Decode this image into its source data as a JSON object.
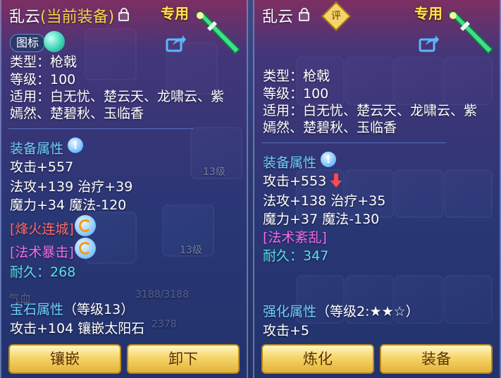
{
  "left": {
    "title_name": "乱云",
    "title_status": "(当前装备)",
    "exclusive": "专用",
    "icon_toggle": "图标",
    "type": "类型：枪戟",
    "level": "等级：100",
    "usable_line1": "适用：白无忧、楚云天、龙啸云、紫",
    "usable_line2": "嫣然、楚碧秋、玉临香",
    "attr_header": "装备属性",
    "attack": "攻击+557",
    "line_magic": "法攻+139 治疗+39",
    "line_power": "魔力+34 魔法-120",
    "skill1": "[烽火连城]",
    "skill2": "[法术暴击]",
    "durability_label": "耐久：",
    "durability_value": "268",
    "gem_header": "宝石属性",
    "gem_level": "（等级13）",
    "gem_line": "攻击+104 镶嵌太阳石",
    "btn_inlay": "镶嵌",
    "btn_unload": "卸下"
  },
  "right": {
    "title_name": "乱云",
    "rate_icon": "评",
    "exclusive": "专用",
    "type": "类型：枪戟",
    "level": "等级：100",
    "usable_line1": "适用：白无忧、楚云天、龙啸云、紫",
    "usable_line2": "嫣然、楚碧秋、玉临香",
    "attr_header": "装备属性",
    "attack": "攻击+553",
    "line_magic": "法攻+138 治疗+35",
    "line_power": "魔力+37 魔法-130",
    "skill1": "[法术紊乱]",
    "durability_label": "耐久：",
    "durability_value": "347",
    "enhance_header": "强化属性",
    "enhance_level": "（等级2:★★☆）",
    "enhance_line": "攻击+5",
    "btn_refine": "炼化",
    "btn_equip": "装备"
  },
  "background": {
    "level_badge_1": "13级",
    "level_badge_2": "13级",
    "hp_label": "气血",
    "hp_value": "3188/3188",
    "mp_value": "2378"
  },
  "colors": {
    "gold": "#f7d34a",
    "cyan": "#59e0f0",
    "pink": "#f56bf0",
    "red": "#ff6b6b",
    "header_blue": "#6ed0ff",
    "button_gold": "#f5d56a"
  }
}
